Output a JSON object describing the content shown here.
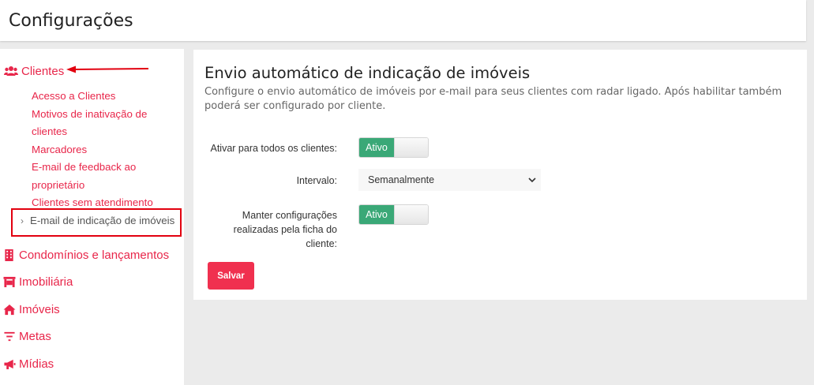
{
  "page": {
    "title": "Configurações"
  },
  "sidebar": {
    "clientes_label": "Clientes",
    "sub_items": [
      {
        "label": "Acesso a Clientes"
      },
      {
        "label": "Motivos de inativação de clientes"
      },
      {
        "label": "Marcadores"
      },
      {
        "label": "E-mail de feedback ao proprietário"
      },
      {
        "label": "Clientes sem atendimento"
      }
    ],
    "active_item": "E-mail de indicação de imóveis",
    "nav": [
      {
        "label": "Condomínios e lançamentos",
        "icon": "building-icon"
      },
      {
        "label": "Imobiliária",
        "icon": "storefront-icon"
      },
      {
        "label": "Imóveis",
        "icon": "home-icon"
      },
      {
        "label": "Metas",
        "icon": "filter-icon"
      },
      {
        "label": "Mídias",
        "icon": "megaphone-icon"
      }
    ]
  },
  "form": {
    "title": "Envio automático de indicação de imóveis",
    "description": "Configure o envio automático de imóveis por e-mail para seus clientes com radar ligado. Após habilitar também poderá ser configurado por cliente.",
    "enable_all_label": "Ativar para todos os clientes:",
    "enable_all_state": "Ativo",
    "interval_label": "Intervalo:",
    "interval_value": "Semanalmente",
    "keep_config_label": "Manter configurações realizadas pela ficha do cliente:",
    "keep_config_state": "Ativo",
    "save_label": "Salvar"
  },
  "colors": {
    "accent": "#e8264a",
    "toggle_on": "#3aa877",
    "save_button": "#f0304f",
    "highlight_box": "#e2000f"
  }
}
